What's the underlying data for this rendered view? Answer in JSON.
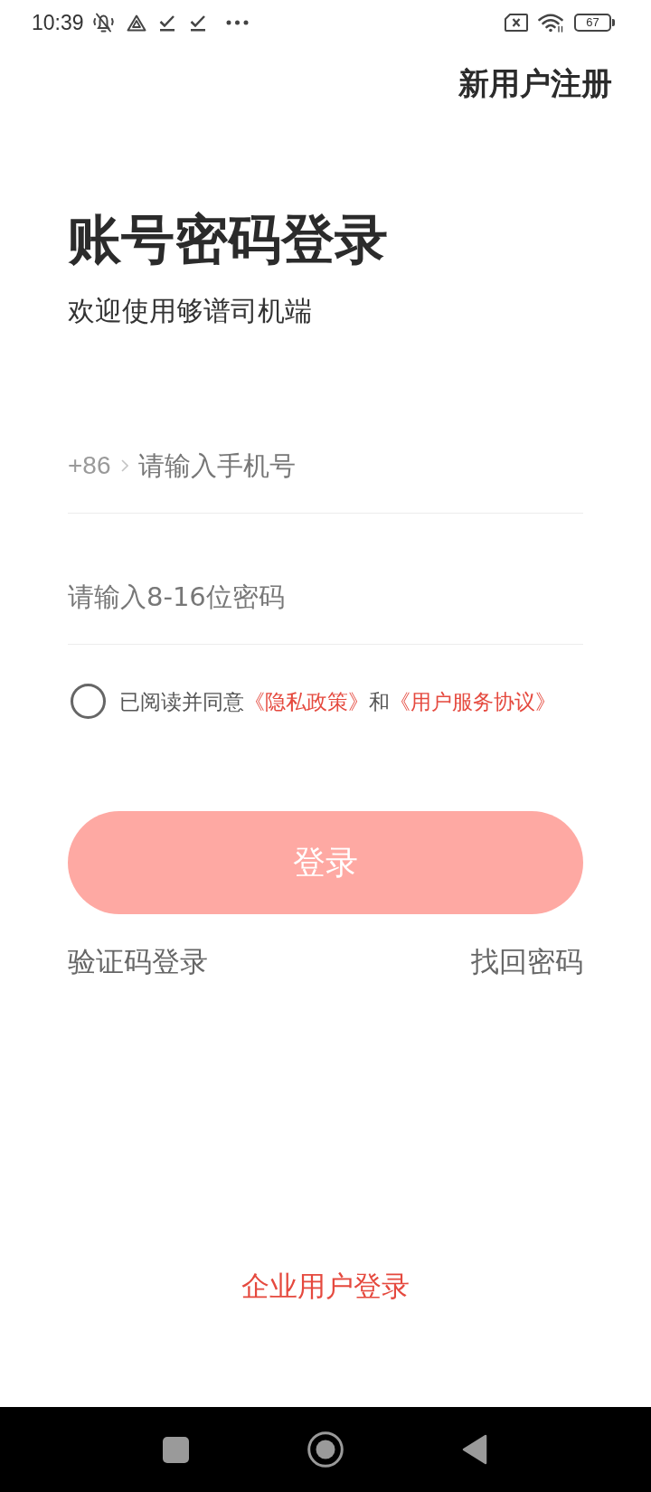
{
  "status_bar": {
    "time": "10:39",
    "battery": "67"
  },
  "header": {
    "register_link": "新用户注册"
  },
  "title": "账号密码登录",
  "subtitle": "欢迎使用够谱司机端",
  "phone_field": {
    "country_code": "+86",
    "placeholder": "请输入手机号"
  },
  "password_field": {
    "placeholder": "请输入8-16位密码"
  },
  "agreement": {
    "checked": false,
    "parts": [
      {
        "kind": "text",
        "text": "已阅读并同意"
      },
      {
        "kind": "link",
        "text": "《隐私政策》"
      },
      {
        "kind": "text",
        "text": "和"
      },
      {
        "kind": "link",
        "text": "《用户服务协议》"
      }
    ]
  },
  "login_button": {
    "label": "登录",
    "disabled": true
  },
  "links": [
    {
      "label": "验证码登录"
    },
    {
      "label": "找回密码"
    }
  ],
  "enterprise_login": "企业用户登录"
}
